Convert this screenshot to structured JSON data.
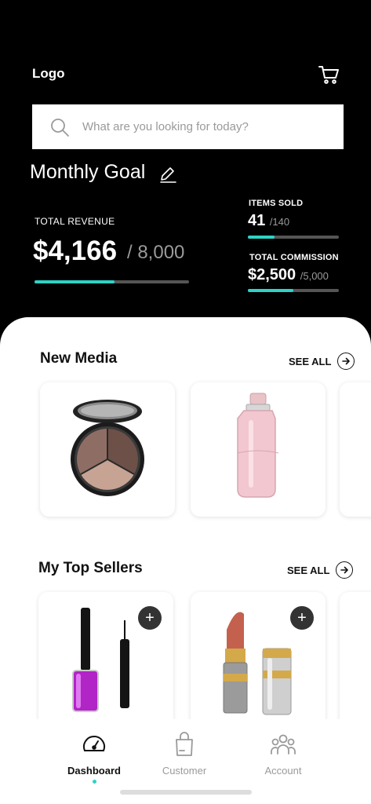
{
  "header": {
    "logo": "Logo",
    "cart_icon": "cart-icon"
  },
  "search": {
    "placeholder": "What are you looking for today?",
    "icon": "search-icon"
  },
  "goal": {
    "title": "Monthly Goal",
    "edit_icon": "pencil-icon",
    "revenue": {
      "label": "TOTAL REVENUE",
      "value": "$4,166",
      "goal": "/ 8,000",
      "progress": 0.52
    },
    "items_sold": {
      "label": "ITEMS SOLD",
      "value": "41",
      "goal": "/140",
      "progress": 0.29
    },
    "commission": {
      "label": "TOTAL COMMISSION",
      "value": "$2,500",
      "goal": "/5,000",
      "progress": 0.5
    }
  },
  "new_media": {
    "title": "New Media",
    "see_all": "SEE ALL",
    "items": [
      {
        "image": "eyeshadow-compact"
      },
      {
        "image": "perfume-bottle"
      },
      {
        "image": "partial-card"
      }
    ]
  },
  "top_sellers": {
    "title": "My Top Sellers",
    "see_all": "SEE ALL",
    "items": [
      {
        "image": "nail-polish-and-eyeliner",
        "add": "+"
      },
      {
        "image": "lipstick-and-tube",
        "add": "+"
      },
      {
        "image": "partial-card"
      }
    ]
  },
  "tabbar": {
    "tabs": [
      {
        "label": "Dashboard",
        "icon": "speedometer-icon",
        "active": true
      },
      {
        "label": "Customer",
        "icon": "shopping-bag-icon",
        "active": false
      },
      {
        "label": "Account",
        "icon": "people-icon",
        "active": false
      }
    ]
  },
  "colors": {
    "accent": "#2ed3c6",
    "background": "#000000",
    "card": "#ffffff"
  }
}
